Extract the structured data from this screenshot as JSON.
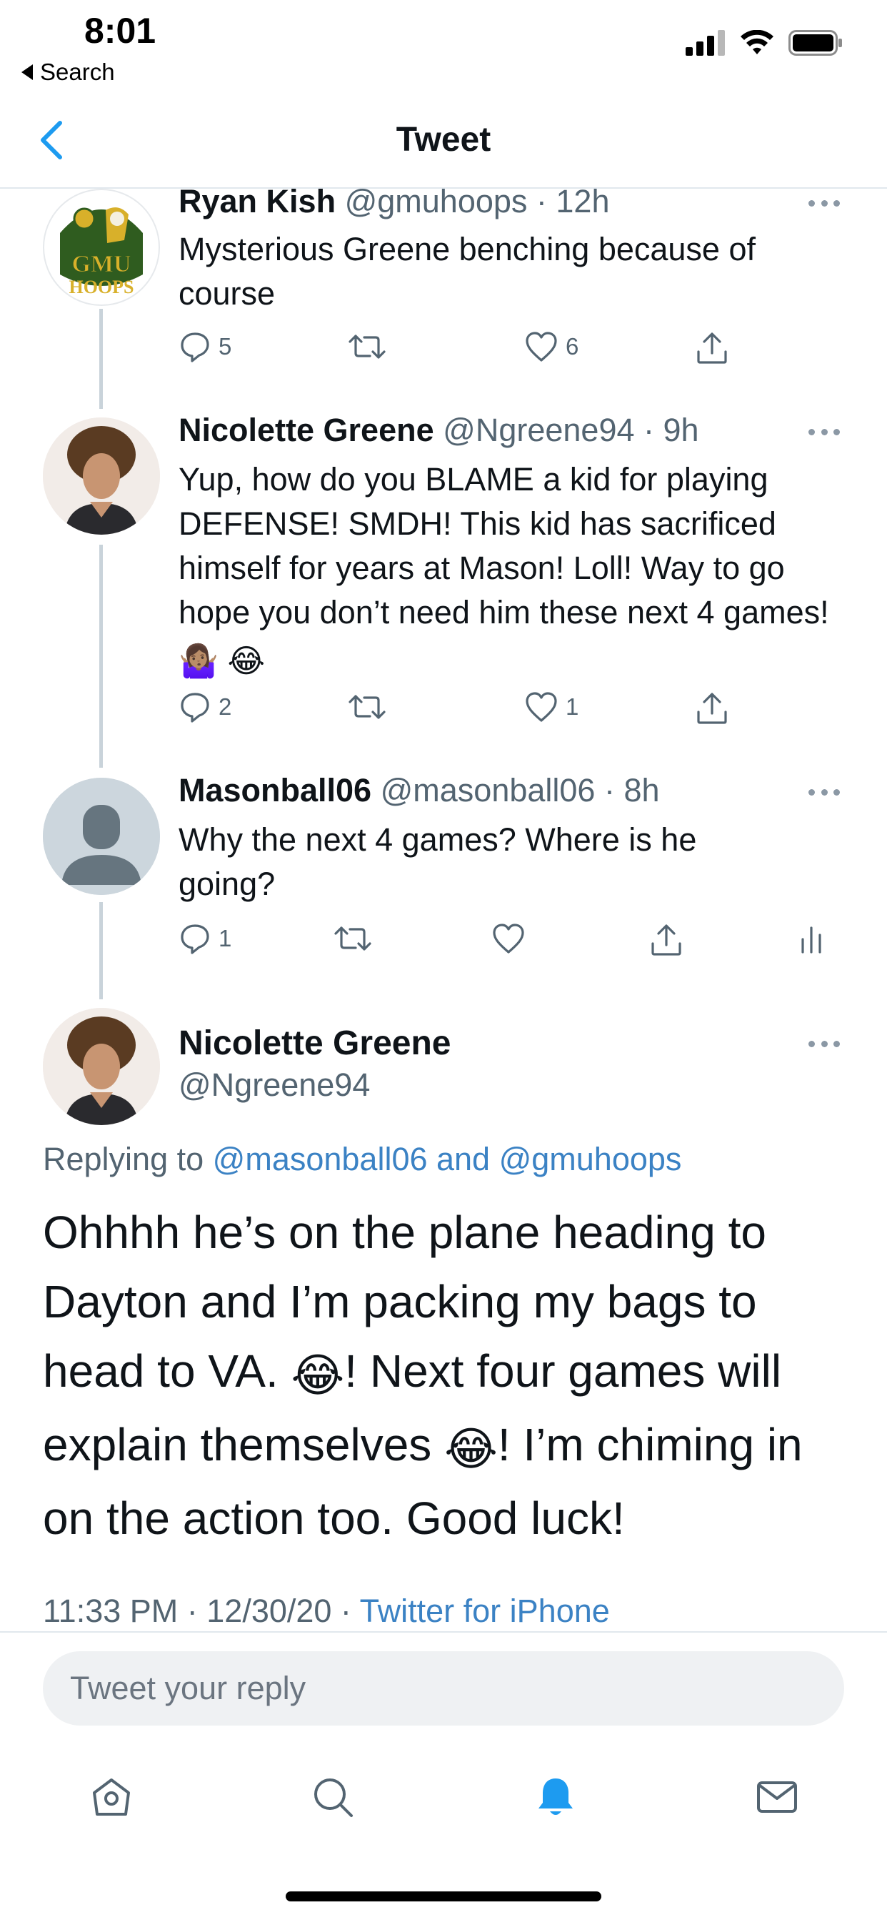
{
  "status_bar": {
    "time": "8:01",
    "back_label": "Search"
  },
  "nav": {
    "title": "Tweet"
  },
  "tweets": [
    {
      "name": "Ryan Kish",
      "handle": "@gmuhoops",
      "time": "12h",
      "text": "Mysterious Greene benching because of course",
      "avatar_text_top": "GMU",
      "avatar_text_bottom": "HOOPS",
      "replies": "5",
      "retweets": "",
      "likes": "6"
    },
    {
      "name": "Nicolette Greene",
      "handle": "@Ngreene94",
      "time": "9h",
      "text": "Yup, how do you BLAME a kid for playing DEFENSE!  SMDH! This kid has sacrificed himself for years at Mason! Loll! Way to go hope you don’t need him these next 4 games!",
      "emoji_1": "🤷🏽‍♀️",
      "emoji_2": "😂",
      "replies": "2",
      "retweets": "",
      "likes": "1"
    },
    {
      "name": "Masonball06",
      "handle": "@masonball06",
      "time": "8h",
      "text": "Why the next 4 games? Where is he going?",
      "replies": "1",
      "retweets": "",
      "likes": ""
    }
  ],
  "focus_tweet": {
    "name": "Nicolette Greene",
    "handle": "@Ngreene94",
    "replying_prefix": "Replying to",
    "replying_to": "@masonball06 and @gmuhoops",
    "text_1": "Ohhhh he’s on the plane heading to Dayton and I’m packing my bags to head to VA.",
    "emoji": "😂",
    "text_2": "!   Next four games will explain themselves",
    "text_3": "! I’m chiming in on the action too. Good luck!",
    "timestamp": "11:33 PM · 12/30/20 ·",
    "source": "Twitter for iPhone"
  },
  "reply_box": {
    "placeholder": "Tweet your reply"
  },
  "icons": {
    "home": "home-icon",
    "search": "search-icon",
    "notifications": "bell-icon",
    "messages": "mail-icon"
  },
  "colors": {
    "accent": "#1d9bf0",
    "link": "#3b82c4",
    "secondary_text": "#536471",
    "avatar_green": "#2f5c1f",
    "avatar_gold": "#d8b02a"
  }
}
